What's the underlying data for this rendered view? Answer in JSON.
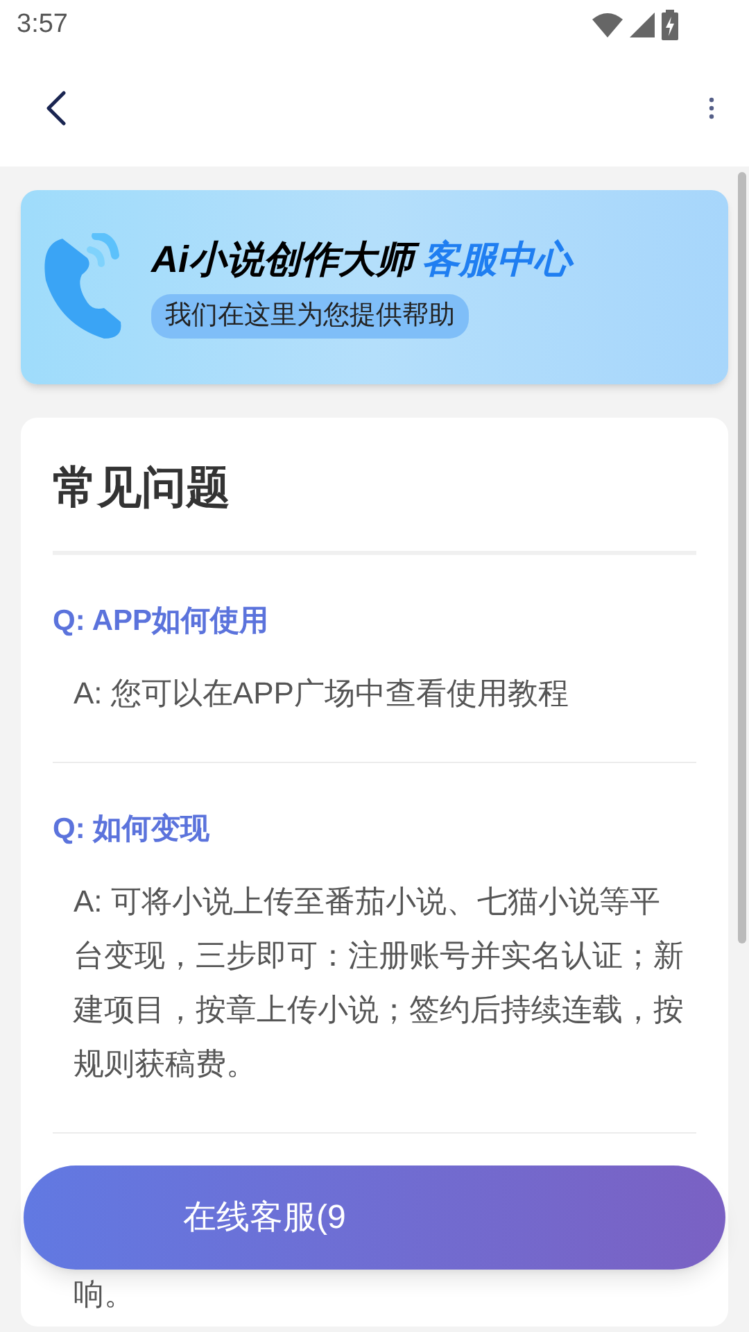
{
  "status_bar": {
    "time": "3:57"
  },
  "banner": {
    "title": "Ai小说创作大师",
    "title_highlight": "客服中心",
    "subtitle": "我们在这里为您提供帮助"
  },
  "faq": {
    "title": "常见问题",
    "items": [
      {
        "question": "Q: APP如何使用",
        "answer": "A: 您可以在APP广场中查看使用教程"
      },
      {
        "question": "Q: 如何变现",
        "answer": "A: 可将小说上传至番茄小说、七猫小说等平台变现，三步即可：注册账号并实名认证；新建项目，按章上传小说；签约后持续连载，按规则获稿费。"
      },
      {
        "answer": "响。"
      }
    ]
  },
  "contact_button": {
    "label": "在线客服(9"
  }
}
